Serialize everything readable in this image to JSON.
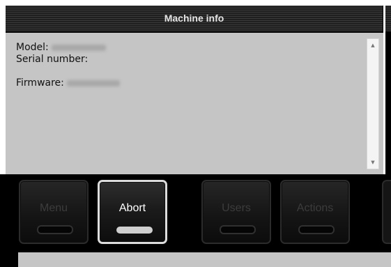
{
  "header": {
    "title": "Machine info"
  },
  "info": {
    "model_label": "Model:",
    "serial_label": "Serial number:",
    "firmware_label": "Firmware:"
  },
  "scrollbar": {
    "up_icon": "▲",
    "down_icon": "▼"
  },
  "toolbar": {
    "buttons": [
      {
        "label": "Menu",
        "active": false
      },
      {
        "label": "Abort",
        "active": true
      },
      {
        "label": "Users",
        "active": false
      },
      {
        "label": "Actions",
        "active": false
      }
    ]
  },
  "colors": {
    "panel_bg": "#c5c5c5",
    "active_button_border": "#dcdcdc",
    "inactive_label": "#3c3c3c"
  }
}
